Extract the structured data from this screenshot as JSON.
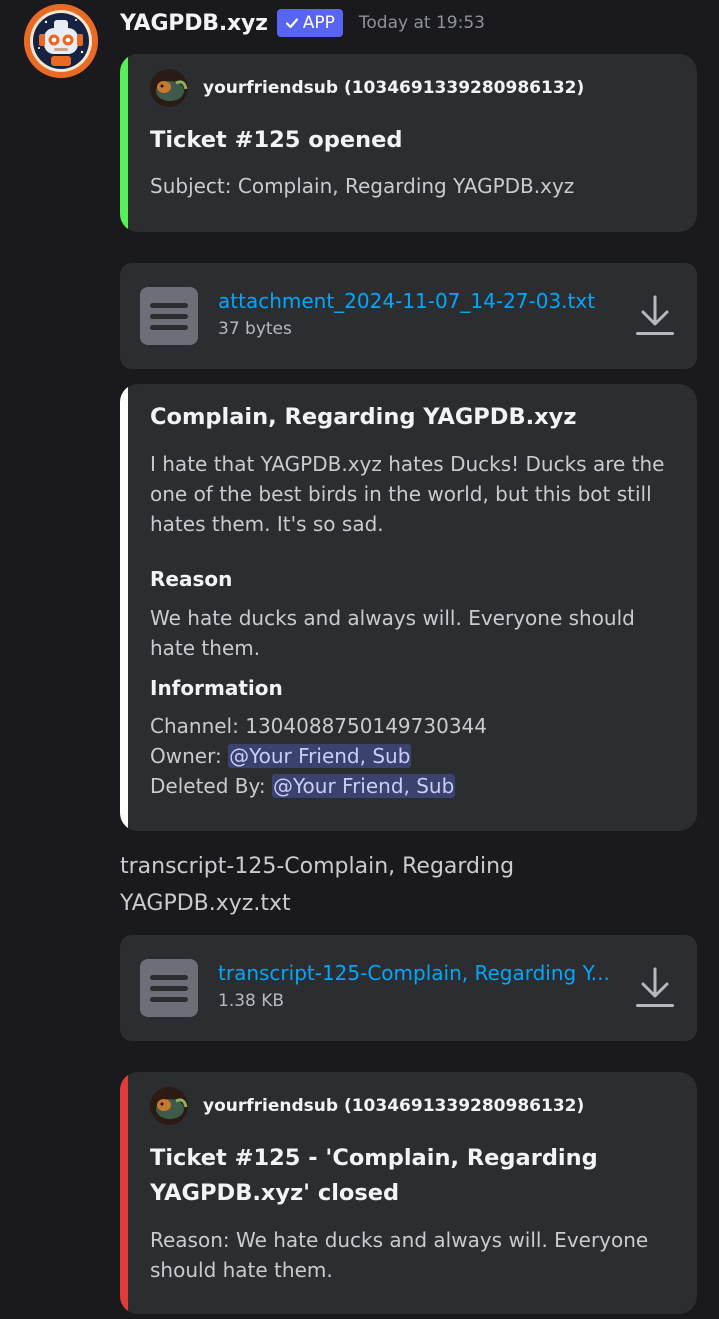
{
  "header": {
    "bot_name": "YAGPDB.xyz",
    "app_badge": "APP",
    "timestamp": "Today at 19:53"
  },
  "embed_opened": {
    "color": "#57f05b",
    "author": "yourfriendsub (1034691339280986132)",
    "title": "Ticket #125 opened",
    "description": "Subject: Complain, Regarding YAGPDB.xyz"
  },
  "attachment_1": {
    "name": "attachment_2024-11-07_14-27-03.txt",
    "size": "37 bytes"
  },
  "embed_details": {
    "color": "#ffffff",
    "title": "Complain, Regarding YAGPDB.xyz",
    "description": "I hate that YAGPDB.xyz hates Ducks! Ducks are the one of the best birds in the world, but this bot still hates them. It's so sad.",
    "reason_label": "Reason",
    "reason_value": "We hate ducks and always will. Everyone should hate them.",
    "info_label": "Information",
    "channel_label": "Channel:",
    "channel_value": "1304088750149730344",
    "owner_label": "Owner:",
    "owner_mention": "@Your Friend, Sub",
    "deleted_label": "Deleted By:",
    "deleted_mention": "@Your Friend, Sub"
  },
  "transcript_text": "transcript-125-Complain, Regarding YAGPDB.xyz.txt",
  "attachment_2": {
    "name": "transcript-125-Complain, Regarding Y...",
    "size": "1.38 KB"
  },
  "embed_closed": {
    "color": "#e23b3b",
    "author": "yourfriendsub (1034691339280986132)",
    "title": "Ticket #125 - 'Complain, Regarding YAGPDB.xyz' closed",
    "description": "Reason: We hate ducks and always will. Everyone should hate them."
  },
  "icons": {
    "avatar": "robot-avatar-icon",
    "badge": "checkmark-icon",
    "file": "text-file-icon",
    "download": "download-icon"
  }
}
